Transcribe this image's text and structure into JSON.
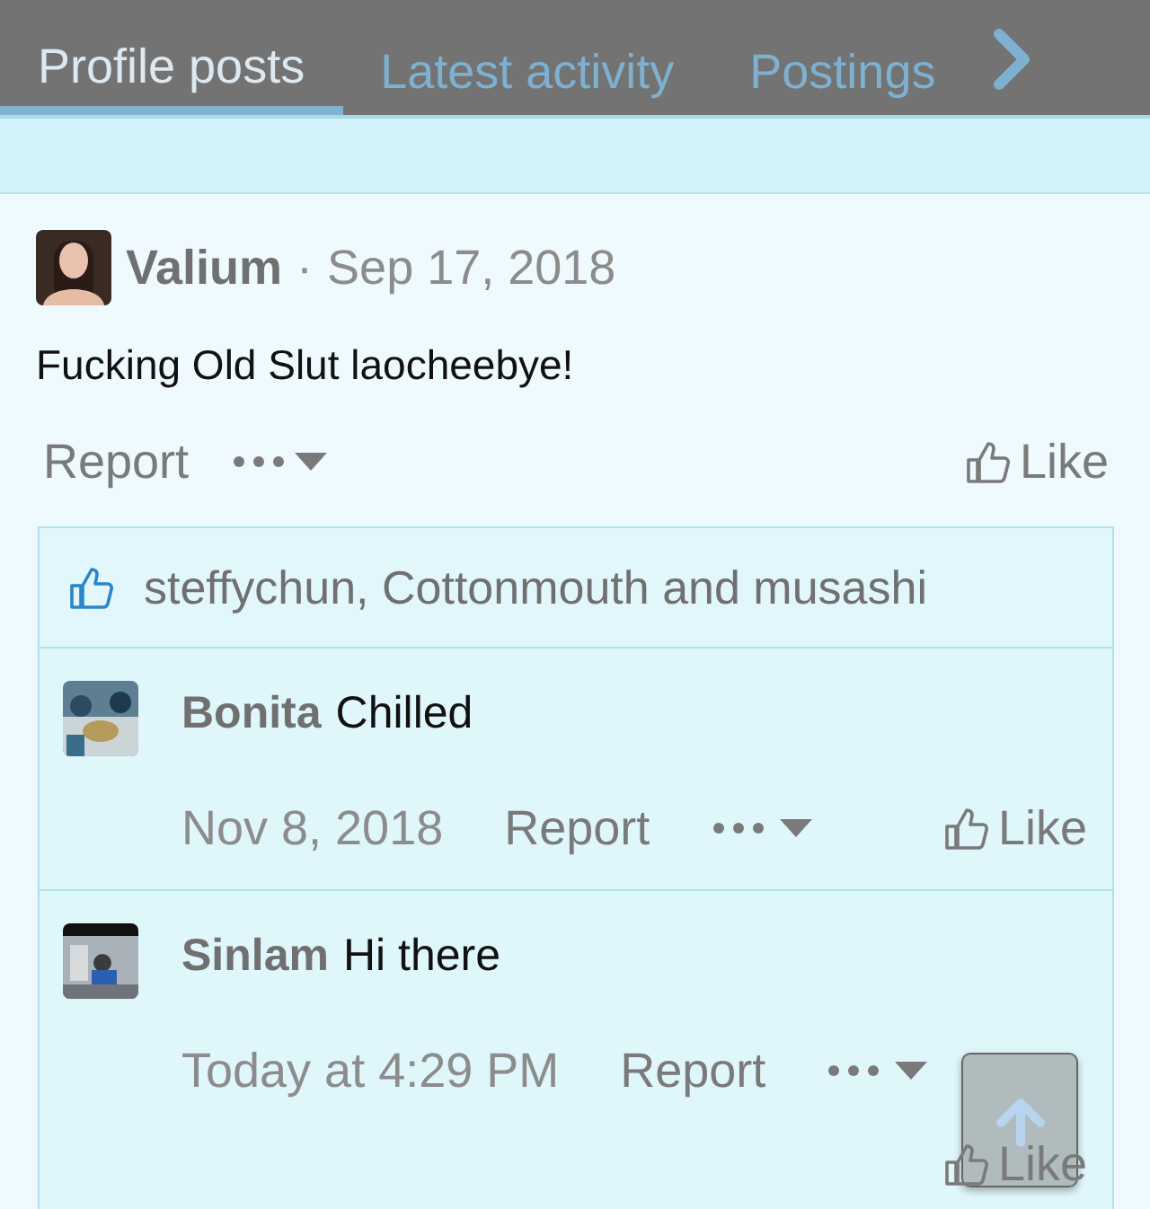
{
  "tabs": [
    {
      "label": "Profile posts",
      "selected": true
    },
    {
      "label": "Latest activity",
      "selected": false
    },
    {
      "label": "Postings",
      "selected": false
    }
  ],
  "post": {
    "author": "Valium",
    "separator": "·",
    "date": "Sep 17, 2018",
    "body": "Fucking Old Slut laocheebye!",
    "report": "Report",
    "like": "Like",
    "likes": "steffychun, Cottonmouth and musashi",
    "comments": [
      {
        "author": "Bonita",
        "text": "Chilled",
        "date": "Nov 8, 2018",
        "report": "Report",
        "like": "Like"
      },
      {
        "author": "Sinlam",
        "text": "Hi there",
        "date": "Today at 4:29 PM",
        "report": "Report",
        "like": "Like"
      }
    ]
  }
}
